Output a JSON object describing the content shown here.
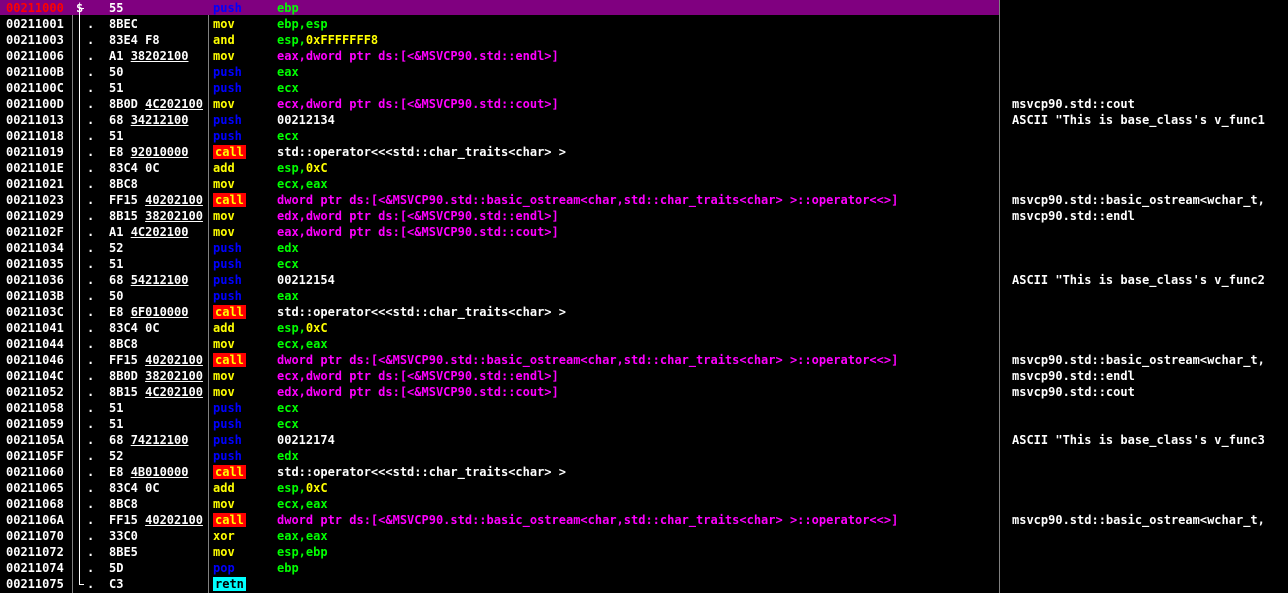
{
  "colors": {
    "background": "#000000",
    "selection": "#800080",
    "selected_address": "#ff0000",
    "push_pop": "#0000ff",
    "mov_add": "#ffff00",
    "call_bg": "#ff0000",
    "retn_bg": "#00ffff",
    "register": "#00ff00",
    "memory": "#ff00ff"
  },
  "icons": {
    "bracket": "procedure-bracket-icon"
  },
  "rows": [
    {
      "addr": "00211000",
      "mark": "$",
      "hex": "55",
      "mn": "push",
      "ops": [
        {
          "t": "ebp",
          "k": "reg"
        }
      ],
      "cmt": ""
    },
    {
      "addr": "00211001",
      "mark": ".",
      "hex": "8BEC",
      "mn": "mov",
      "ops": [
        {
          "t": "ebp,esp",
          "k": "reg"
        }
      ],
      "cmt": ""
    },
    {
      "addr": "00211003",
      "mark": ".",
      "hex": "83E4 F8",
      "mn": "and",
      "ops": [
        {
          "t": "esp,",
          "k": "reg"
        },
        {
          "t": "0xFFFFFFF8",
          "k": "imm"
        }
      ],
      "cmt": ""
    },
    {
      "addr": "00211006",
      "mark": ".",
      "hex": "A1 38202100",
      "mn": "mov",
      "ops": [
        {
          "t": "eax,dword ptr ds:[<&MSVCP90.std::endl>]",
          "k": "mem"
        }
      ],
      "cmt": ""
    },
    {
      "addr": "0021100B",
      "mark": ".",
      "hex": "50",
      "mn": "push",
      "ops": [
        {
          "t": "eax",
          "k": "reg"
        }
      ],
      "cmt": ""
    },
    {
      "addr": "0021100C",
      "mark": ".",
      "hex": "51",
      "mn": "push",
      "ops": [
        {
          "t": "ecx",
          "k": "reg"
        }
      ],
      "cmt": ""
    },
    {
      "addr": "0021100D",
      "mark": ".",
      "hex": "8B0D 4C202100",
      "mn": "mov",
      "ops": [
        {
          "t": "ecx,dword ptr ds:[<&MSVCP90.std::cout>]",
          "k": "mem"
        }
      ],
      "cmt": "msvcp90.std::cout"
    },
    {
      "addr": "00211013",
      "mark": ".",
      "hex": "68 34212100",
      "mn": "push",
      "ops": [
        {
          "t": "00212134",
          "k": "plain"
        }
      ],
      "cmt": "ASCII \"This is base_class's v_func1"
    },
    {
      "addr": "00211018",
      "mark": ".",
      "hex": "51",
      "mn": "push",
      "ops": [
        {
          "t": "ecx",
          "k": "reg"
        }
      ],
      "cmt": ""
    },
    {
      "addr": "00211019",
      "mark": ".",
      "hex": "E8 92010000",
      "mn": "call",
      "ops": [
        {
          "t": "std::operator<<<std::char_traits<char> >",
          "k": "plain"
        }
      ],
      "cmt": ""
    },
    {
      "addr": "0021101E",
      "mark": ".",
      "hex": "83C4 0C",
      "mn": "add",
      "ops": [
        {
          "t": "esp,",
          "k": "reg"
        },
        {
          "t": "0xC",
          "k": "imm"
        }
      ],
      "cmt": ""
    },
    {
      "addr": "00211021",
      "mark": ".",
      "hex": "8BC8",
      "mn": "mov",
      "ops": [
        {
          "t": "ecx,eax",
          "k": "reg"
        }
      ],
      "cmt": ""
    },
    {
      "addr": "00211023",
      "mark": ".",
      "hex": "FF15 40202100",
      "mn": "call",
      "ops": [
        {
          "t": "dword ptr ds:[<&MSVCP90.std::basic_ostream<char,std::char_traits<char> >::operator<<>]",
          "k": "mem"
        }
      ],
      "cmt": "msvcp90.std::basic_ostream<wchar_t,"
    },
    {
      "addr": "00211029",
      "mark": ".",
      "hex": "8B15 38202100",
      "mn": "mov",
      "ops": [
        {
          "t": "edx,dword ptr ds:[<&MSVCP90.std::endl>]",
          "k": "mem"
        }
      ],
      "cmt": "msvcp90.std::endl"
    },
    {
      "addr": "0021102F",
      "mark": ".",
      "hex": "A1 4C202100",
      "mn": "mov",
      "ops": [
        {
          "t": "eax,dword ptr ds:[<&MSVCP90.std::cout>]",
          "k": "mem"
        }
      ],
      "cmt": ""
    },
    {
      "addr": "00211034",
      "mark": ".",
      "hex": "52",
      "mn": "push",
      "ops": [
        {
          "t": "edx",
          "k": "reg"
        }
      ],
      "cmt": ""
    },
    {
      "addr": "00211035",
      "mark": ".",
      "hex": "51",
      "mn": "push",
      "ops": [
        {
          "t": "ecx",
          "k": "reg"
        }
      ],
      "cmt": ""
    },
    {
      "addr": "00211036",
      "mark": ".",
      "hex": "68 54212100",
      "mn": "push",
      "ops": [
        {
          "t": "00212154",
          "k": "plain"
        }
      ],
      "cmt": "ASCII \"This is base_class's v_func2"
    },
    {
      "addr": "0021103B",
      "mark": ".",
      "hex": "50",
      "mn": "push",
      "ops": [
        {
          "t": "eax",
          "k": "reg"
        }
      ],
      "cmt": ""
    },
    {
      "addr": "0021103C",
      "mark": ".",
      "hex": "E8 6F010000",
      "mn": "call",
      "ops": [
        {
          "t": "std::operator<<<std::char_traits<char> >",
          "k": "plain"
        }
      ],
      "cmt": ""
    },
    {
      "addr": "00211041",
      "mark": ".",
      "hex": "83C4 0C",
      "mn": "add",
      "ops": [
        {
          "t": "esp,",
          "k": "reg"
        },
        {
          "t": "0xC",
          "k": "imm"
        }
      ],
      "cmt": ""
    },
    {
      "addr": "00211044",
      "mark": ".",
      "hex": "8BC8",
      "mn": "mov",
      "ops": [
        {
          "t": "ecx,eax",
          "k": "reg"
        }
      ],
      "cmt": ""
    },
    {
      "addr": "00211046",
      "mark": ".",
      "hex": "FF15 40202100",
      "mn": "call",
      "ops": [
        {
          "t": "dword ptr ds:[<&MSVCP90.std::basic_ostream<char,std::char_traits<char> >::operator<<>]",
          "k": "mem"
        }
      ],
      "cmt": "msvcp90.std::basic_ostream<wchar_t,"
    },
    {
      "addr": "0021104C",
      "mark": ".",
      "hex": "8B0D 38202100",
      "mn": "mov",
      "ops": [
        {
          "t": "ecx,dword ptr ds:[<&MSVCP90.std::endl>]",
          "k": "mem"
        }
      ],
      "cmt": "msvcp90.std::endl"
    },
    {
      "addr": "00211052",
      "mark": ".",
      "hex": "8B15 4C202100",
      "mn": "mov",
      "ops": [
        {
          "t": "edx,dword ptr ds:[<&MSVCP90.std::cout>]",
          "k": "mem"
        }
      ],
      "cmt": "msvcp90.std::cout"
    },
    {
      "addr": "00211058",
      "mark": ".",
      "hex": "51",
      "mn": "push",
      "ops": [
        {
          "t": "ecx",
          "k": "reg"
        }
      ],
      "cmt": ""
    },
    {
      "addr": "00211059",
      "mark": ".",
      "hex": "51",
      "mn": "push",
      "ops": [
        {
          "t": "ecx",
          "k": "reg"
        }
      ],
      "cmt": ""
    },
    {
      "addr": "0021105A",
      "mark": ".",
      "hex": "68 74212100",
      "mn": "push",
      "ops": [
        {
          "t": "00212174",
          "k": "plain"
        }
      ],
      "cmt": "ASCII \"This is base_class's v_func3"
    },
    {
      "addr": "0021105F",
      "mark": ".",
      "hex": "52",
      "mn": "push",
      "ops": [
        {
          "t": "edx",
          "k": "reg"
        }
      ],
      "cmt": ""
    },
    {
      "addr": "00211060",
      "mark": ".",
      "hex": "E8 4B010000",
      "mn": "call",
      "ops": [
        {
          "t": "std::operator<<<std::char_traits<char> >",
          "k": "plain"
        }
      ],
      "cmt": ""
    },
    {
      "addr": "00211065",
      "mark": ".",
      "hex": "83C4 0C",
      "mn": "add",
      "ops": [
        {
          "t": "esp,",
          "k": "reg"
        },
        {
          "t": "0xC",
          "k": "imm"
        }
      ],
      "cmt": ""
    },
    {
      "addr": "00211068",
      "mark": ".",
      "hex": "8BC8",
      "mn": "mov",
      "ops": [
        {
          "t": "ecx,eax",
          "k": "reg"
        }
      ],
      "cmt": ""
    },
    {
      "addr": "0021106A",
      "mark": ".",
      "hex": "FF15 40202100",
      "mn": "call",
      "ops": [
        {
          "t": "dword ptr ds:[<&MSVCP90.std::basic_ostream<char,std::char_traits<char> >::operator<<>]",
          "k": "mem"
        }
      ],
      "cmt": "msvcp90.std::basic_ostream<wchar_t,"
    },
    {
      "addr": "00211070",
      "mark": ".",
      "hex": "33C0",
      "mn": "xor",
      "ops": [
        {
          "t": "eax,eax",
          "k": "reg"
        }
      ],
      "cmt": ""
    },
    {
      "addr": "00211072",
      "mark": ".",
      "hex": "8BE5",
      "mn": "mov",
      "ops": [
        {
          "t": "esp,ebp",
          "k": "reg"
        }
      ],
      "cmt": ""
    },
    {
      "addr": "00211074",
      "mark": ".",
      "hex": "5D",
      "mn": "pop",
      "ops": [
        {
          "t": "ebp",
          "k": "reg"
        }
      ],
      "cmt": ""
    },
    {
      "addr": "00211075",
      "mark": ".",
      "hex": "C3",
      "mn": "retn",
      "ops": [],
      "cmt": ""
    }
  ]
}
